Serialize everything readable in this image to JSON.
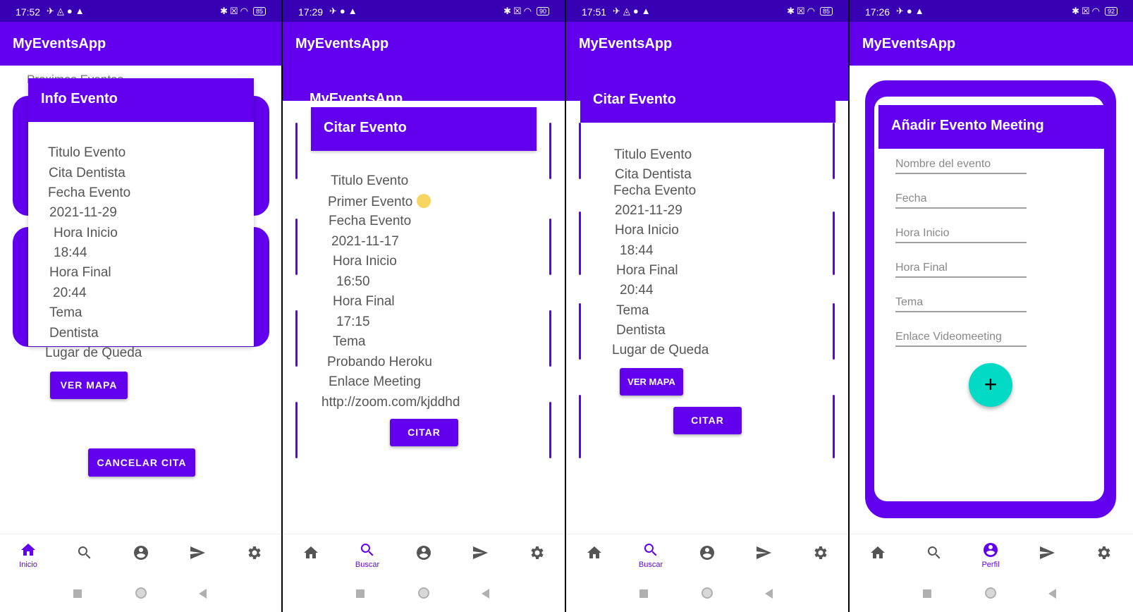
{
  "app_title": "MyEventsApp",
  "nav": {
    "home": "Inicio",
    "search": "Buscar",
    "profile": "Perfil"
  },
  "screens": [
    {
      "status": {
        "time": "17:52",
        "battery": "85"
      },
      "dialog_title": "Info Evento",
      "hidden_header": "Proximos Eventos",
      "items": [
        "Titulo Evento",
        "Cita Dentista",
        "Fecha Evento",
        "2021-11-29",
        "Hora Inicio",
        "18:44",
        "Hora Final",
        "20:44",
        "Tema",
        "Dentista",
        "Lugar de Queda"
      ],
      "map_button": "VER MAPA",
      "cancel_button": "CANCELAR CITA"
    },
    {
      "status": {
        "time": "17:29",
        "battery": "90"
      },
      "outer_title": "MyEventsApp",
      "dialog_title": "Citar Evento",
      "items": [
        "Titulo Evento",
        "Primer Evento",
        "Fecha Evento",
        "2021-11-17",
        "Hora Inicio",
        "16:50",
        "Hora Final",
        "17:15",
        "Tema",
        "Probando Heroku",
        "Enlace Meeting",
        "http://zoom.com/kjddhd"
      ],
      "cite_button": "CITAR"
    },
    {
      "status": {
        "time": "17:51",
        "battery": "85"
      },
      "dialog_title": "Citar Evento",
      "items": [
        "Titulo Evento",
        "Cita Dentista",
        "Fecha Evento",
        "2021-11-29",
        "Hora Inicio",
        "18:44",
        "Hora Final",
        "20:44",
        "Tema",
        "Dentista",
        "Lugar de Queda"
      ],
      "map_button": "VER MAPA",
      "cite_button": "CITAR"
    },
    {
      "status": {
        "time": "17:26",
        "battery": "92"
      },
      "dialog_title": "Añadir Evento Meeting",
      "fields": [
        "Nombre del evento",
        "Fecha",
        "Hora Inicio",
        "Hora Final",
        "Tema",
        "Enlace Videomeeting"
      ],
      "fab": "+"
    }
  ],
  "colors": {
    "primary": "#6200ee",
    "status": "#3700b3",
    "accent": "#03dac5"
  }
}
